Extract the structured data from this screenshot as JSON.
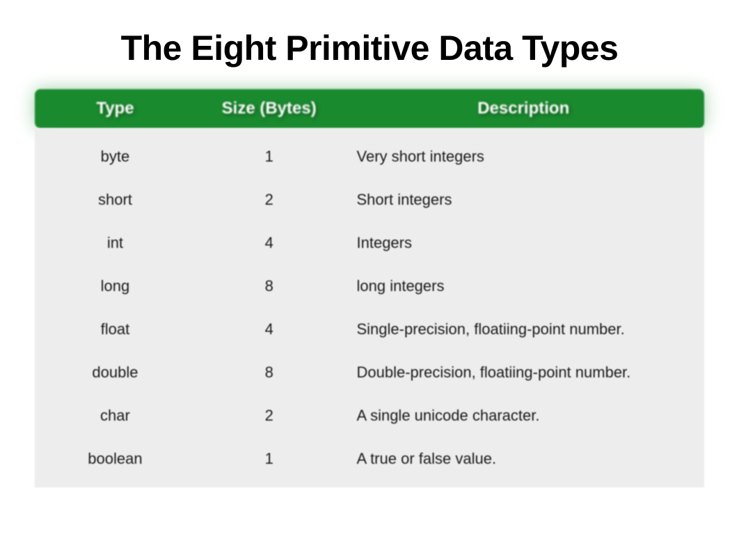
{
  "title": "The Eight Primitive Data Types",
  "table": {
    "headers": {
      "type": "Type",
      "size": "Size  (Bytes)",
      "description": "Description"
    },
    "rows": [
      {
        "type": "byte",
        "size": "1",
        "description": "Very short integers"
      },
      {
        "type": "short",
        "size": "2",
        "description": "Short integers"
      },
      {
        "type": "int",
        "size": "4",
        "description": "Integers"
      },
      {
        "type": "long",
        "size": "8",
        "description": "long integers"
      },
      {
        "type": "float",
        "size": "4",
        "description": "Single-precision, floatiing-point number."
      },
      {
        "type": "double",
        "size": "8",
        "description": "Double-precision, floatiing-point number."
      },
      {
        "type": "char",
        "size": "2",
        "description": "A single unicode character."
      },
      {
        "type": "boolean",
        "size": "1",
        "description": "A true or false value."
      }
    ]
  }
}
